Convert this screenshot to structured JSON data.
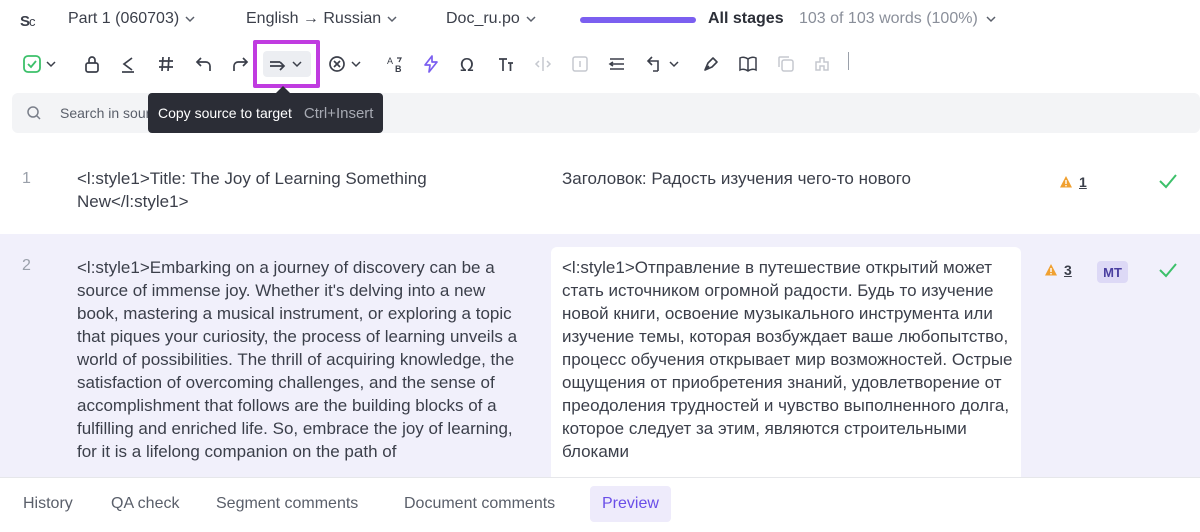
{
  "header": {
    "logo_icon": "logo-icon",
    "part": "Part 1 (060703)",
    "languages": "English → Russian",
    "document": "Doc_ru.po",
    "stages": "All stages",
    "word_count": "103 of 103 words (100%)",
    "progress": 1.0
  },
  "toolbar": {
    "items": [
      "confirm-check-icon",
      "lock-icon",
      "clear-target-icon",
      "tags-icon",
      "undo-icon",
      "redo-icon",
      "copy-source-icon",
      "cancel-circle-icon",
      "spell-check-icon",
      "lightning-icon",
      "omega-icon",
      "text-case-icon",
      "split-icon",
      "info-box-icon",
      "merge-icon",
      "revert-icon",
      "glossary-pen-icon",
      "book-icon",
      "copy-icon",
      "puzzle-icon"
    ]
  },
  "search": {
    "placeholder": "Search in source"
  },
  "tooltip": {
    "label": "Copy source to target",
    "shortcut": "Ctrl+Insert"
  },
  "segments": [
    {
      "number": "1",
      "source": "<l:style1>Title: The Joy of Learning Something New</l:style1>",
      "target": "Заголовок: Радость изучения чего-то нового",
      "warnings": "1",
      "status": "confirmed"
    },
    {
      "number": "2",
      "source": "<l:style1>Embarking on a journey of discovery can be a source of immense joy. Whether it's delving into a new book, mastering a musical instrument, or exploring a topic that piques your curiosity, the process of learning unveils a world of possibilities. The thrill of acquiring knowledge, the satisfaction of overcoming challenges, and the sense of accomplishment that follows are the building blocks of a fulfilling and enriched life. So, embrace the joy of learning, for it is a lifelong companion on the path of",
      "target": "<l:style1>Отправление в путешествие открытий может стать источником огромной радости. Будь то изучение новой книги, освоение музыкального инструмента или изучение темы, которая возбуждает ваше любопытство, процесс обучения открывает мир возможностей. Острые ощущения от приобретения знаний, удовлетворение от преодоления трудностей и чувство выполненного долга, которое следует за этим, являются строительными блоками",
      "warnings": "3",
      "mt_badge": "MT",
      "status": "confirmed"
    }
  ],
  "bottom_tabs": [
    {
      "label": "History",
      "active": false
    },
    {
      "label": "QA check",
      "active": false
    },
    {
      "label": "Segment comments",
      "active": false
    },
    {
      "label": "Document comments",
      "active": false
    },
    {
      "label": "Preview",
      "active": true
    }
  ],
  "colors": {
    "accent": "#7b5ff0",
    "highlight": "#c03be0",
    "warning": "#f0a030",
    "confirm": "#3cc06a"
  }
}
